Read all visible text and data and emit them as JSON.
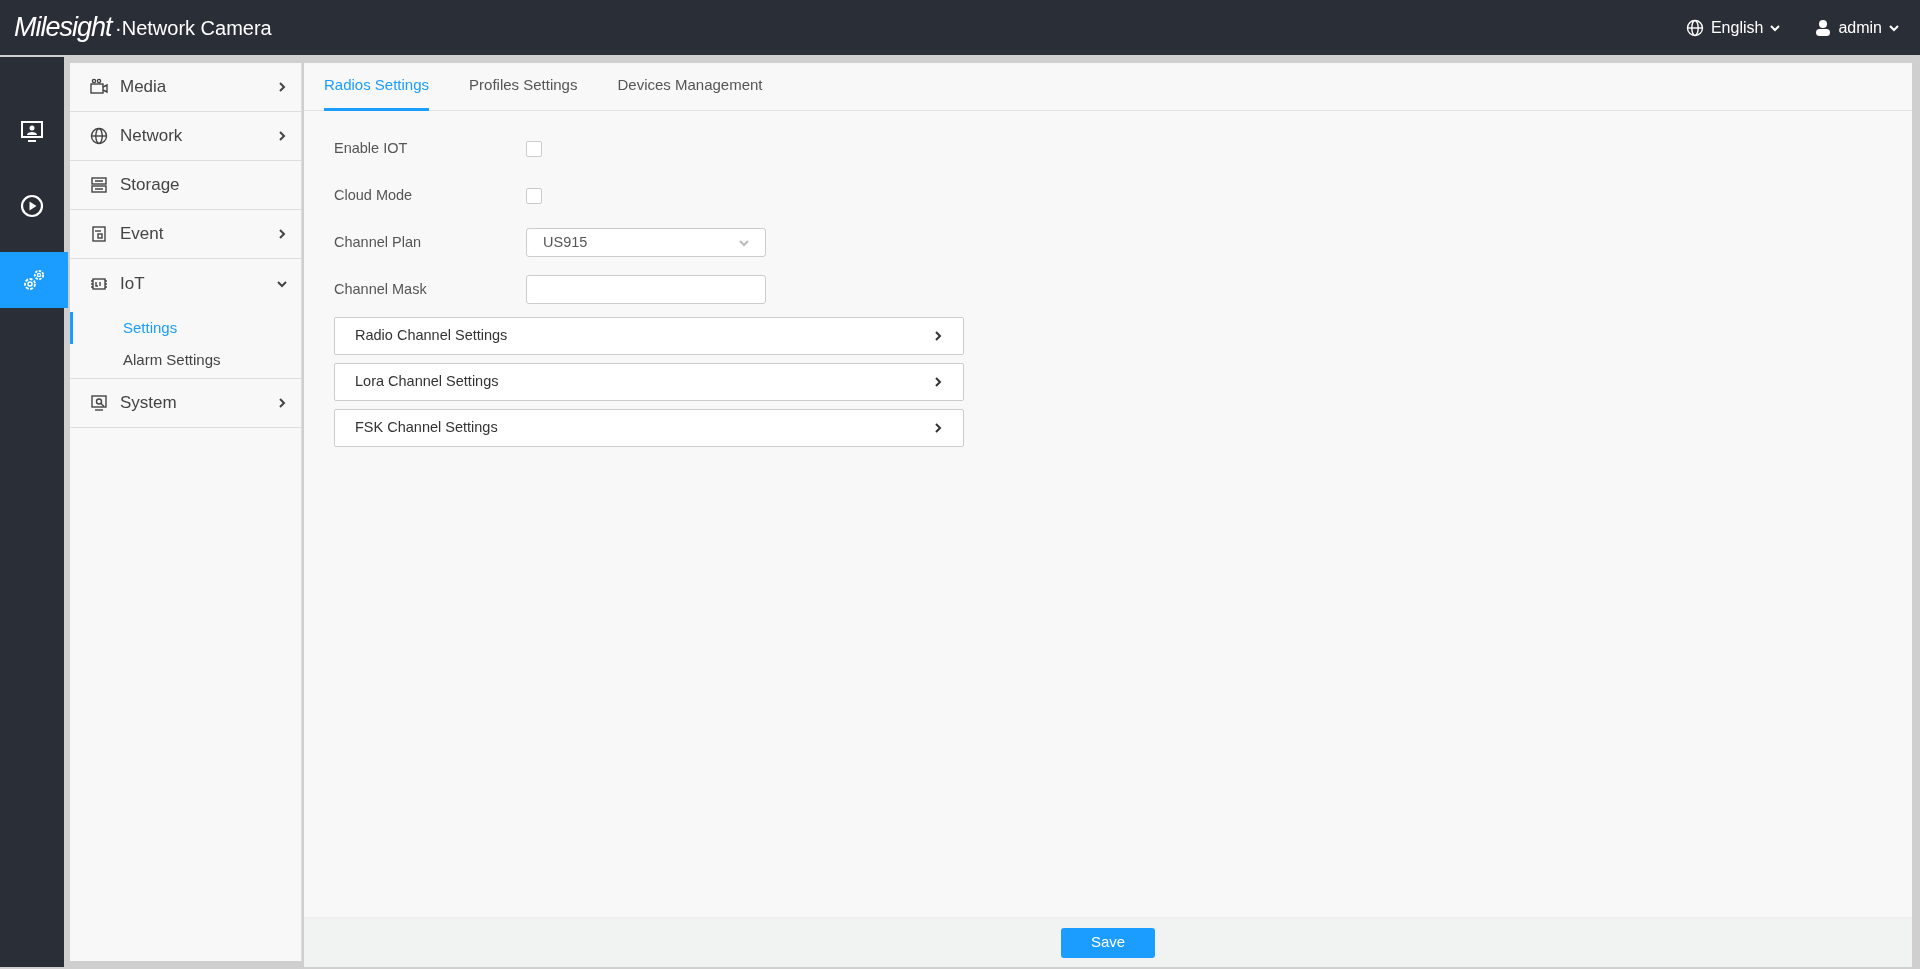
{
  "header": {
    "logo": "Milesight",
    "product": "·Network Camera",
    "language": "English",
    "user": "admin"
  },
  "rail": [
    {
      "kind": "live",
      "selected": false
    },
    {
      "kind": "playback",
      "selected": false
    },
    {
      "kind": "settings",
      "selected": true
    }
  ],
  "menu": [
    {
      "kind": "group",
      "label": "Media",
      "expanded": false
    },
    {
      "kind": "group",
      "label": "Network",
      "expanded": false
    },
    {
      "kind": "link",
      "label": "Storage"
    },
    {
      "kind": "group",
      "label": "Event",
      "expanded": false
    },
    {
      "kind": "group",
      "label": "IoT",
      "expanded": true,
      "children": [
        {
          "label": "Settings",
          "selected": true
        },
        {
          "label": "Alarm Settings",
          "selected": false
        }
      ]
    },
    {
      "kind": "group",
      "label": "System",
      "expanded": false
    }
  ],
  "tabs": [
    {
      "label": "Radios Settings",
      "selected": true
    },
    {
      "label": "Profiles Settings",
      "selected": false
    },
    {
      "label": "Devices Management",
      "selected": false
    }
  ],
  "form": [
    {
      "kind": "checkbox",
      "label": "Enable IOT",
      "checked": false
    },
    {
      "kind": "checkbox",
      "label": "Cloud Mode",
      "checked": false
    },
    {
      "kind": "select",
      "label": "Channel Plan",
      "value": "US915"
    },
    {
      "kind": "text",
      "label": "Channel Mask"
    }
  ],
  "sections": [
    {
      "label": "Radio Channel Settings",
      "expanded": false
    },
    {
      "label": "Lora Channel Settings",
      "expanded": false
    },
    {
      "label": "FSK Channel Settings",
      "expanded": false
    }
  ],
  "save_button": "Save"
}
